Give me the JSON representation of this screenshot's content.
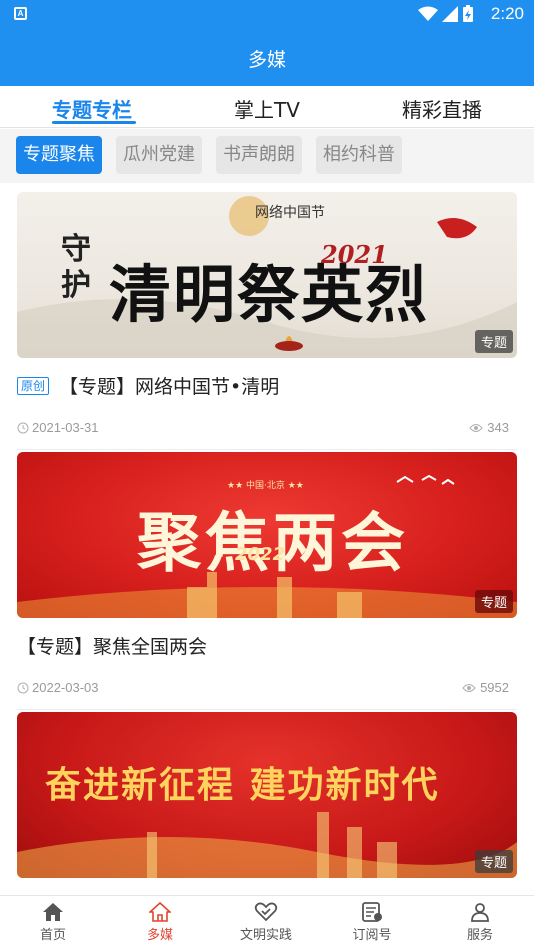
{
  "statusbar": {
    "time": "2:20",
    "notification_icon": "A"
  },
  "header": {
    "title": "多媒"
  },
  "tabs": [
    {
      "label": "专题专栏",
      "active": true
    },
    {
      "label": "掌上TV",
      "active": false
    },
    {
      "label": "精彩直播",
      "active": false
    }
  ],
  "chips": [
    {
      "label": "专题聚焦",
      "active": true
    },
    {
      "label": "瓜州党建",
      "active": false
    },
    {
      "label": "书声朗朗",
      "active": false
    },
    {
      "label": "相约科普",
      "active": false
    }
  ],
  "cards": [
    {
      "banner_text_main": "清明祭英烈",
      "banner_text_side": "守护",
      "banner_text_year": "2021",
      "banner_logo": "网络中国节",
      "badge": "专题",
      "original_tag": "原创",
      "title": "【专题】网络中国节•清明",
      "date": "2021-03-31",
      "views": "343"
    },
    {
      "banner_text_main": "聚焦两会",
      "banner_text_sub": "★★ 中国·北京 ★★",
      "banner_text_year": "2022",
      "badge": "专题",
      "title": "【专题】聚焦全国两会",
      "date": "2022-03-03",
      "views": "5952"
    },
    {
      "banner_text_main": "奋进新征程 建功新时代",
      "badge": "专题"
    }
  ],
  "bottom_nav": [
    {
      "label": "首页",
      "icon": "home-icon",
      "active": false
    },
    {
      "label": "多媒",
      "icon": "media-home-icon",
      "active": true
    },
    {
      "label": "文明实践",
      "icon": "heart-hands-icon",
      "active": false
    },
    {
      "label": "订阅号",
      "icon": "subscription-icon",
      "active": false
    },
    {
      "label": "服务",
      "icon": "service-icon",
      "active": false
    }
  ],
  "colors": {
    "primary": "#1f8ff0",
    "active_nav": "#e2442f"
  }
}
